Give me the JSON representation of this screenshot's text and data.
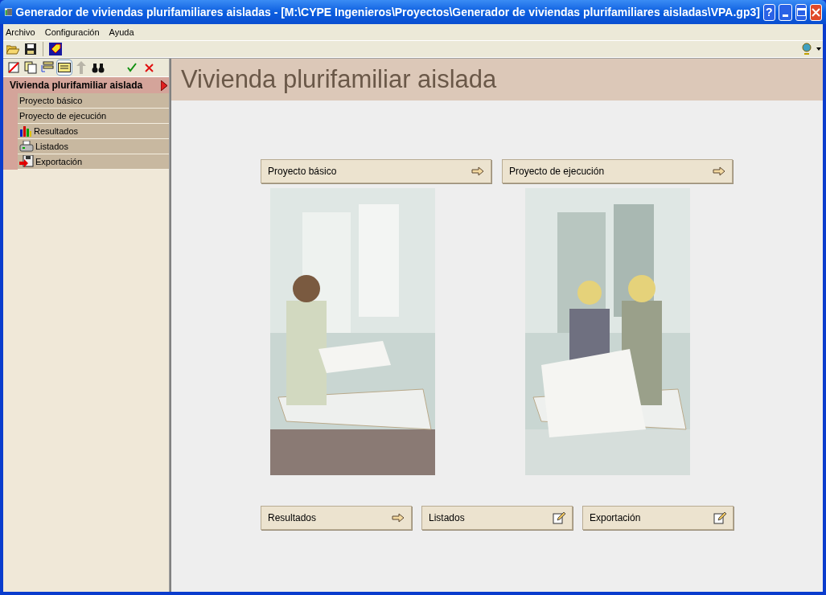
{
  "window": {
    "title": "Generador de viviendas plurifamiliares aisladas - [M:\\CYPE Ingenieros\\Proyectos\\Generador de viviendas plurifamiliares aisladas\\VPA.gp3]",
    "help": "?"
  },
  "menu": [
    "Archivo",
    "Configuración",
    "Ayuda"
  ],
  "tree": {
    "label": "Vivienda plurifamiliar aislada",
    "expanded": true,
    "children": [
      {
        "label": "Proyecto básico",
        "kind": "plain"
      },
      {
        "label": "Proyecto de ejecución",
        "kind": "plain"
      },
      {
        "label": "Resultados",
        "kind": "chart"
      },
      {
        "label": "Listados",
        "kind": "printer"
      },
      {
        "label": "Exportación",
        "kind": "export"
      }
    ]
  },
  "page": {
    "title": "Vivienda plurifamiliar aislada",
    "top_buttons": [
      {
        "label": "Proyecto básico",
        "kind": "arrow"
      },
      {
        "label": "Proyecto de ejecución",
        "kind": "arrow"
      }
    ],
    "bottom_buttons": [
      {
        "label": "Resultados",
        "kind": "arrow"
      },
      {
        "label": "Listados",
        "kind": "edit"
      },
      {
        "label": "Exportación",
        "kind": "edit"
      }
    ]
  }
}
